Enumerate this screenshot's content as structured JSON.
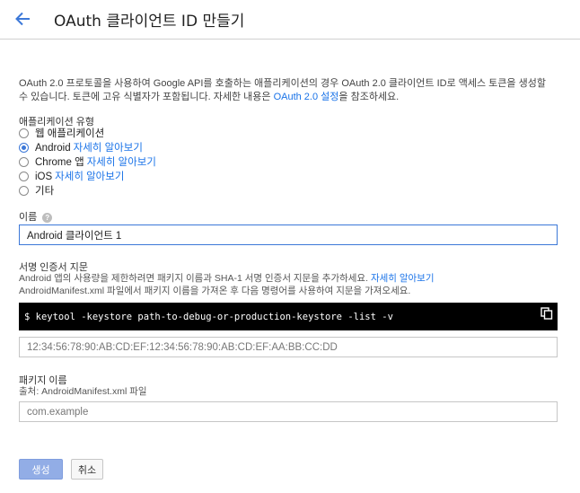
{
  "header": {
    "title": "OAuth 클라이언트 ID 만들기"
  },
  "intro": {
    "text_before": "OAuth 2.0 프로토콜을 사용하여 Google API를 호출하는 애플리케이션의 경우 OAuth 2.0 클라이언트 ID로 액세스 토큰을 생성할 수 있습니다. 토큰에 고유 식별자가 포함됩니다. 자세한 내용은 ",
    "link_text": "OAuth 2.0 설정",
    "text_after": "을 참조하세요."
  },
  "app_type": {
    "label": "애플리케이션 유형",
    "options": [
      {
        "label": "웹 애플리케이션",
        "link": "",
        "checked": false
      },
      {
        "label": "Android",
        "link": "자세히 알아보기",
        "checked": true
      },
      {
        "label": "Chrome 앱",
        "link": "자세히 알아보기",
        "checked": false
      },
      {
        "label": "iOS",
        "link": "자세히 알아보기",
        "checked": false
      },
      {
        "label": "기타",
        "link": "",
        "checked": false
      }
    ]
  },
  "name_field": {
    "label": "이름",
    "value": "Android 클라이언트 1"
  },
  "cert_section": {
    "label": "서명 인증서 지문",
    "desc_line1": "Android 앱의 사용량을 제한하려면 패키지 이름과 SHA-1 서명 인증서 지문을 추가하세요. ",
    "desc_link": "자세히 알아보기",
    "desc_line2": "AndroidManifest.xml 파일에서 패키지 이름을 가져온 후 다음 명령어를 사용하여 지문을 가져오세요.",
    "command": "$ keytool -keystore path-to-debug-or-production-keystore -list -v",
    "fingerprint_placeholder": "12:34:56:78:90:AB:CD:EF:12:34:56:78:90:AB:CD:EF:AA:BB:CC:DD"
  },
  "package_section": {
    "label": "패키지 이름",
    "source": "출처: AndroidManifest.xml 파일",
    "placeholder": "com.example"
  },
  "actions": {
    "create": "생성",
    "cancel": "취소"
  },
  "colors": {
    "accent": "#3c78d8",
    "link": "#1a73e8",
    "primary_button": "#92ade6"
  }
}
